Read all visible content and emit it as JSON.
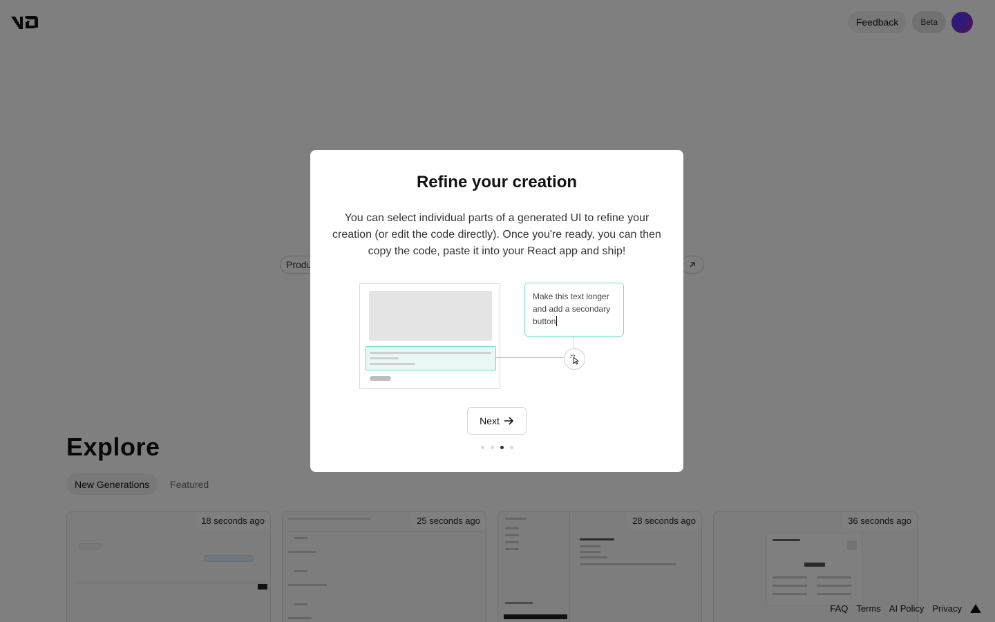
{
  "header": {
    "logo": "v0-logo",
    "feedback_label": "Feedback",
    "beta_label": "Beta",
    "avatar": "user-avatar"
  },
  "background_prompt": {
    "left_chip_text": "Produ"
  },
  "explore": {
    "title": "Explore",
    "tabs": [
      {
        "label": "New Generations",
        "active": true
      },
      {
        "label": "Featured",
        "active": false
      }
    ],
    "cards": [
      {
        "time": "18 seconds ago"
      },
      {
        "time": "25 seconds ago"
      },
      {
        "time": "28 seconds ago"
      },
      {
        "time": "36 seconds ago"
      }
    ]
  },
  "footer": {
    "links": [
      "FAQ",
      "Terms",
      "AI Policy",
      "Privacy"
    ],
    "icon": "vercel-triangle-icon"
  },
  "modal": {
    "title": "Refine your creation",
    "description": "You can select individual parts of a generated UI to refine your creation (or edit the code directly). Once you're ready, you can then copy the code, paste it into your React app and ship!",
    "prompt_text": "Make this text longer and add a secondary button",
    "next_label": "Next",
    "steps_total": 4,
    "current_step": 3
  },
  "colors": {
    "accent": "#5fe0c7",
    "overlay": "rgba(0,0,0,0.5)"
  }
}
